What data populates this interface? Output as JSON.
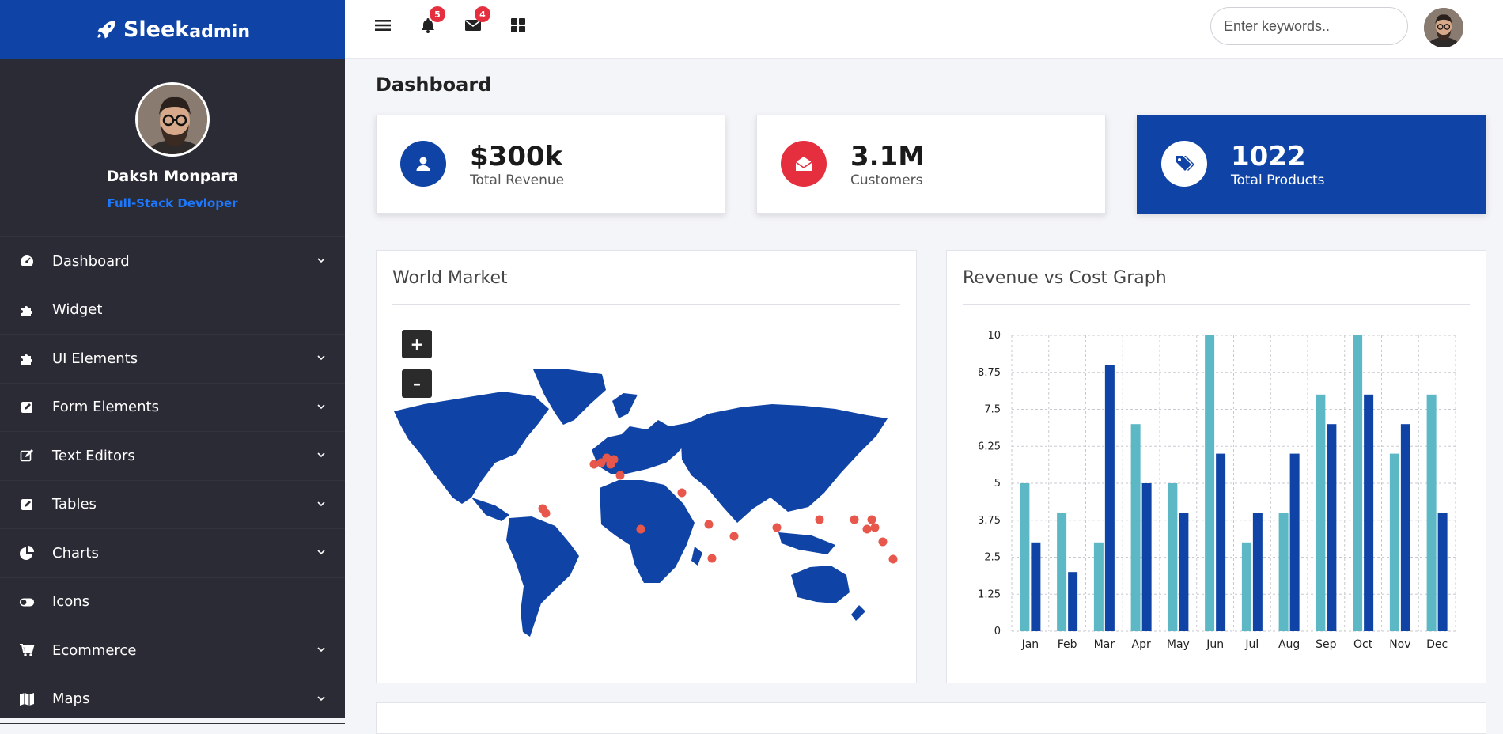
{
  "brand": {
    "name_main": "Sleek",
    "name_sub": "admin"
  },
  "profile": {
    "name": "Daksh Monpara",
    "role": "Full-Stack Devloper"
  },
  "nav": {
    "items": [
      {
        "label": "Dashboard",
        "icon": "dashboard-icon",
        "expandable": true
      },
      {
        "label": "Widget",
        "icon": "puzzle-icon",
        "expandable": false
      },
      {
        "label": "UI Elements",
        "icon": "puzzle-icon",
        "expandable": true
      },
      {
        "label": "Form Elements",
        "icon": "edit-square-icon",
        "expandable": true
      },
      {
        "label": "Text Editors",
        "icon": "pencil-square-icon",
        "expandable": true
      },
      {
        "label": "Tables",
        "icon": "edit-square-icon",
        "expandable": true
      },
      {
        "label": "Charts",
        "icon": "pie-chart-icon",
        "expandable": true
      },
      {
        "label": "Icons",
        "icon": "toggle-icon",
        "expandable": false
      },
      {
        "label": "Ecommerce",
        "icon": "cart-icon",
        "expandable": true
      },
      {
        "label": "Maps",
        "icon": "map-icon",
        "expandable": true
      }
    ]
  },
  "topbar": {
    "notifications_count": "5",
    "messages_count": "4",
    "search_placeholder": "Enter keywords.."
  },
  "page_title": "Dashboard",
  "stats": [
    {
      "value": "$300k",
      "label": "Total Revenue",
      "icon": "user-icon"
    },
    {
      "value": "3.1M",
      "label": "Customers",
      "icon": "envelope-open-icon"
    },
    {
      "value": "1022",
      "label": "Total Products",
      "icon": "tags-icon"
    }
  ],
  "colors": {
    "primary": "#0f44a6",
    "accent_red": "#e52f3f",
    "sidebar": "#2b2b36",
    "teal": "#5cb8c4",
    "marker": "#e8574b"
  },
  "world_market": {
    "title": "World Market",
    "zoom_in": "+",
    "zoom_out": "–"
  },
  "chart_data": {
    "type": "bar",
    "title": "Revenue vs Cost Graph",
    "categories": [
      "Jan",
      "Feb",
      "Mar",
      "Apr",
      "May",
      "Jun",
      "Jul",
      "Aug",
      "Sep",
      "Oct",
      "Nov",
      "Dec"
    ],
    "series": [
      {
        "values": [
          5,
          4,
          3,
          7,
          5,
          10,
          3,
          4,
          8,
          10,
          6,
          8
        ],
        "color": "#5cb8c4"
      },
      {
        "values": [
          3,
          2,
          9,
          5,
          4,
          6,
          4,
          6,
          7,
          8,
          7,
          4
        ],
        "color": "#0f44a6"
      }
    ],
    "y_ticks": [
      "0",
      "1.25",
      "2.5",
      "3.75",
      "5",
      "6.25",
      "7.5",
      "8.75",
      "10"
    ],
    "ylim": [
      0,
      10
    ],
    "grid": true,
    "legend": "none"
  }
}
